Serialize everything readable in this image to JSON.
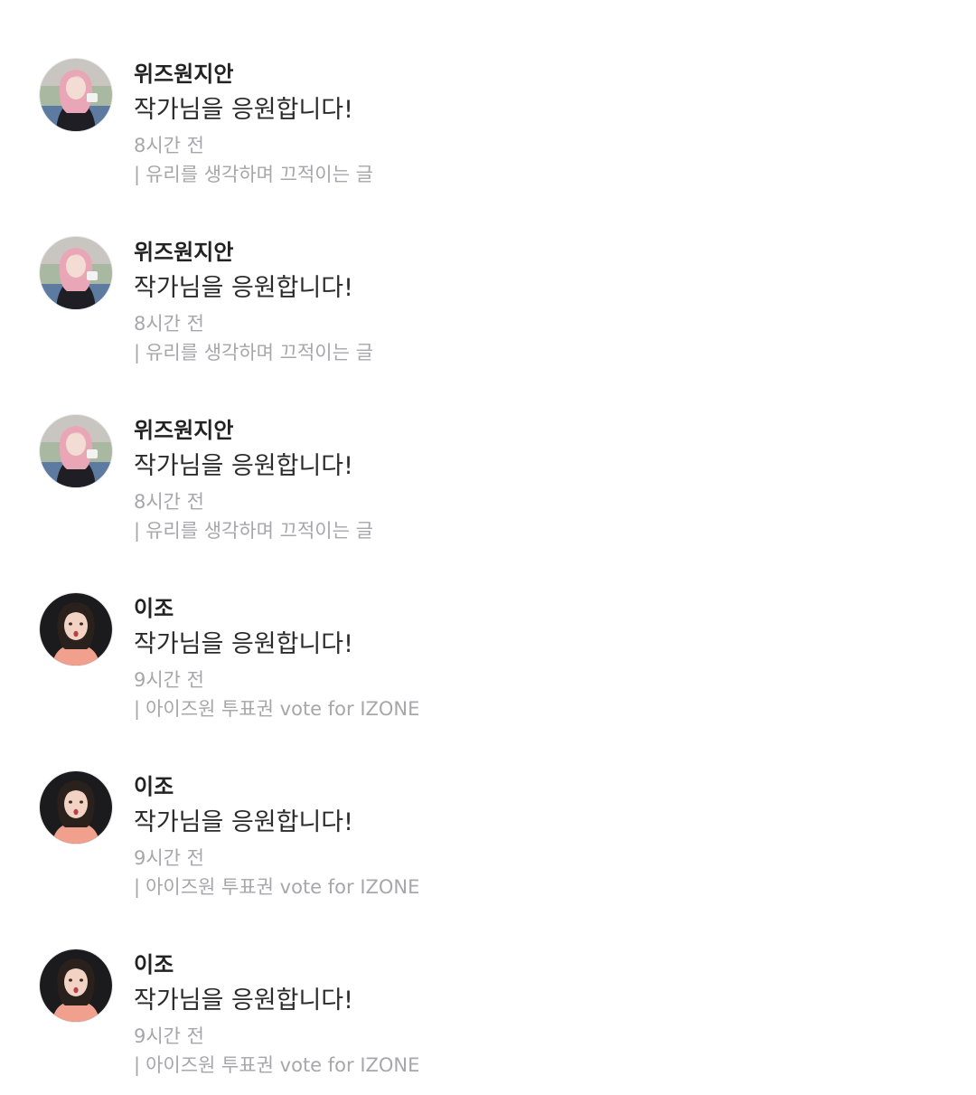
{
  "comments": [
    {
      "author": "위즈원지안",
      "avatar_icon": "profile-photo-pink-hair",
      "text": "작가님을 응원합니다!",
      "time": "8시간 전",
      "source_prefix": "|",
      "source": "유리를 생각하며 끄적이는 글"
    },
    {
      "author": "위즈원지안",
      "avatar_icon": "profile-photo-pink-hair",
      "text": "작가님을 응원합니다!",
      "time": "8시간 전",
      "source_prefix": "|",
      "source": "유리를 생각하며 끄적이는 글"
    },
    {
      "author": "위즈원지안",
      "avatar_icon": "profile-photo-pink-hair",
      "text": "작가님을 응원합니다!",
      "time": "8시간 전",
      "source_prefix": "|",
      "source": "유리를 생각하며 끄적이는 글"
    },
    {
      "author": "이조",
      "avatar_icon": "profile-photo-dark-hair",
      "text": "작가님을 응원합니다!",
      "time": "9시간 전",
      "source_prefix": "|",
      "source": "아이즈원 투표권 vote for IZONE"
    },
    {
      "author": "이조",
      "avatar_icon": "profile-photo-dark-hair",
      "text": "작가님을 응원합니다!",
      "time": "9시간 전",
      "source_prefix": "|",
      "source": "아이즈원 투표권 vote for IZONE"
    },
    {
      "author": "이조",
      "avatar_icon": "profile-photo-dark-hair",
      "text": "작가님을 응원합니다!",
      "time": "9시간 전",
      "source_prefix": "|",
      "source": "아이즈원 투표권 vote for IZONE"
    }
  ],
  "colors": {
    "author": "#222222",
    "text": "#2b2b2b",
    "meta": "#a7a7ab",
    "background": "#ffffff"
  }
}
